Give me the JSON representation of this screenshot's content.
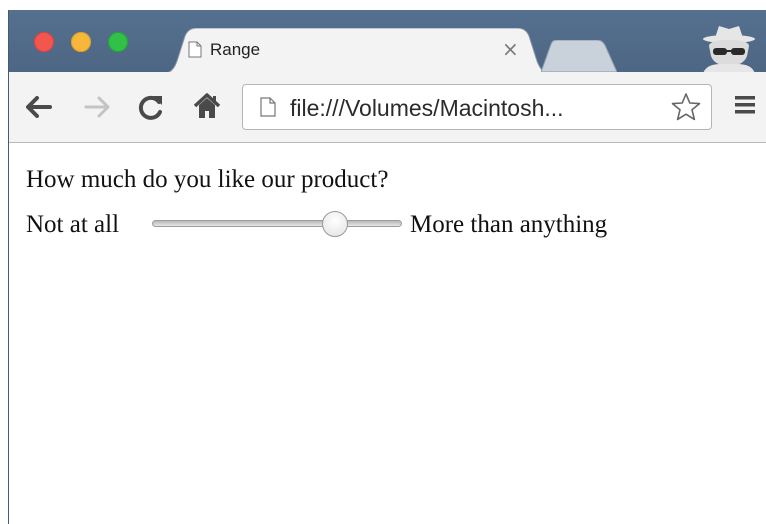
{
  "browser": {
    "tab": {
      "title": "Range",
      "close_glyph": "×",
      "icon": "document-icon"
    },
    "address_bar": {
      "url": "file:///Volumes/Macintosh...",
      "icon": "page-icon",
      "bookmark_icon": "star-icon"
    },
    "toolbar_icons": [
      "back-arrow-icon",
      "forward-arrow-icon",
      "reload-icon",
      "home-icon",
      "menu-icon"
    ],
    "profile_icon": "incognito-icon"
  },
  "page": {
    "question": "How much do you like our product?",
    "range": {
      "min_label": "Not at all",
      "max_label": "More than anything",
      "value_fraction": 0.76
    }
  },
  "colors": {
    "titlebar": "#4d6684",
    "traffic_close": "#f3554f",
    "traffic_minimize": "#f6b73a",
    "traffic_maximize": "#32c048"
  }
}
